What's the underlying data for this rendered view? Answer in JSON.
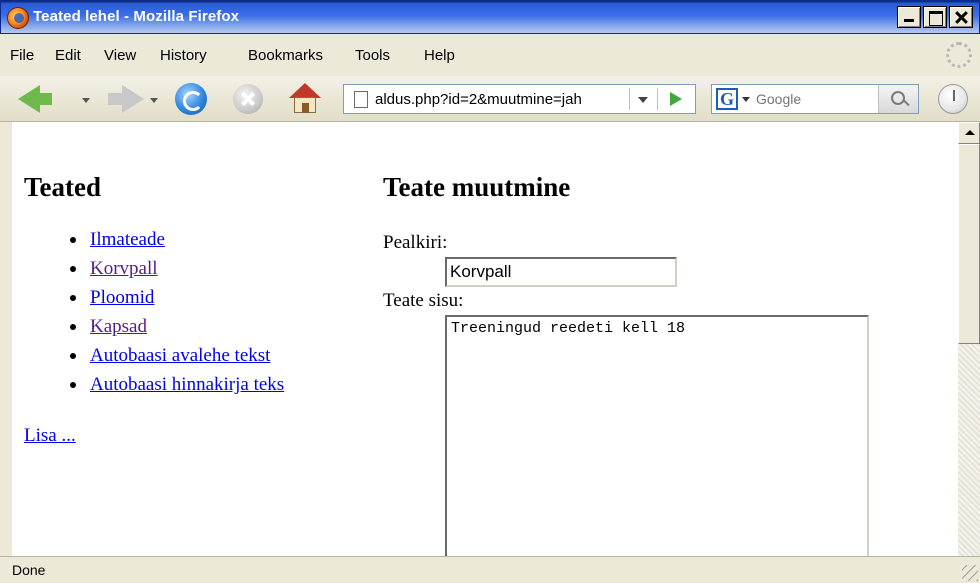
{
  "window": {
    "title": "Teated lehel - Mozilla Firefox"
  },
  "menu": {
    "items": [
      "File",
      "Edit",
      "View",
      "History",
      "Bookmarks",
      "Tools",
      "Help"
    ]
  },
  "navigation": {
    "url": "aldus.php?id=2&muutmine=jah",
    "search_placeholder": "Google",
    "search_engine_icon": "G"
  },
  "left": {
    "heading": "Teated",
    "links": [
      {
        "label": "Ilmateade",
        "visited": false
      },
      {
        "label": "Korvpall",
        "visited": true
      },
      {
        "label": "Ploomid",
        "visited": false
      },
      {
        "label": "Kapsad",
        "visited": true
      },
      {
        "label": "Autobaasi avalehe tekst",
        "visited": false
      },
      {
        "label": "Autobaasi hinnakirja teks",
        "visited": false
      }
    ],
    "add_link": "Lisa ..."
  },
  "right": {
    "heading": "Teate muutmine",
    "title_label": "Pealkiri:",
    "title_value": "Korvpall",
    "body_label": "Teate sisu:",
    "body_value": "Treeningud reedeti kell 18"
  },
  "status": {
    "text": "Done"
  },
  "colors": {
    "link": "#0000ee",
    "visited_link": "#551a8b"
  }
}
